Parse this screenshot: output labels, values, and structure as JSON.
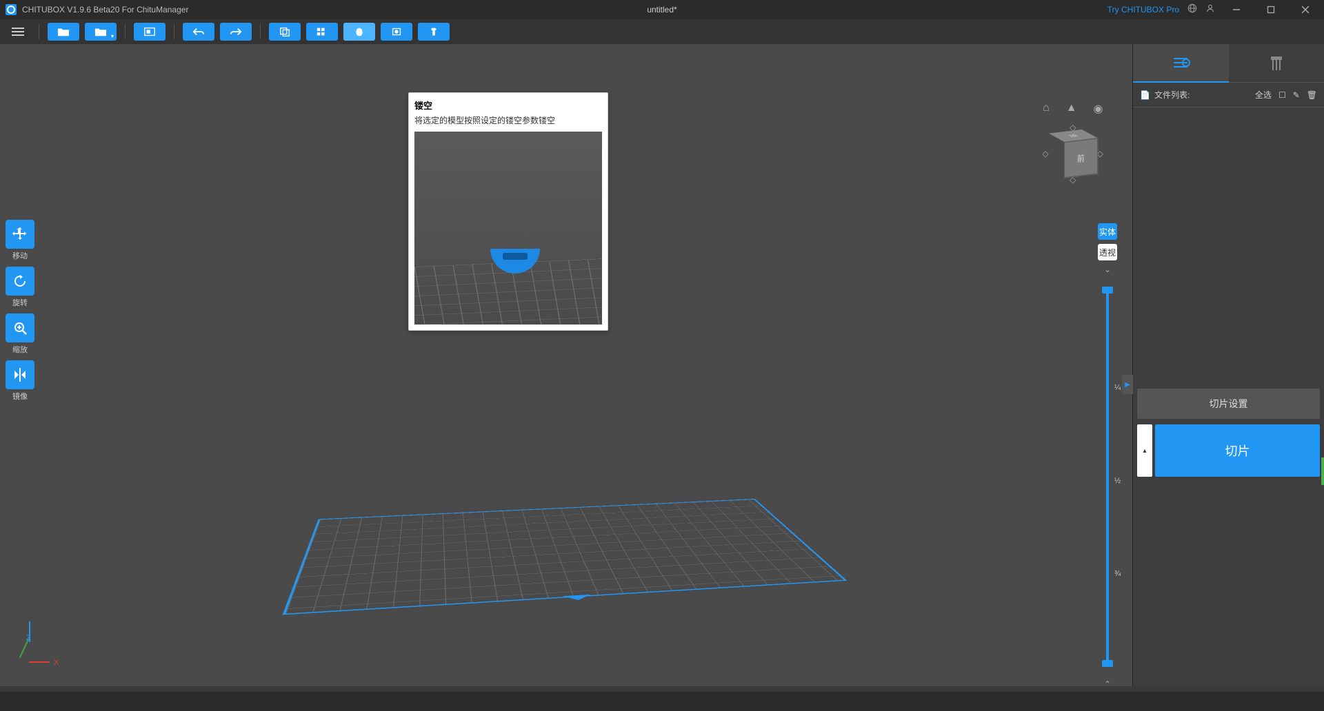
{
  "titlebar": {
    "app_title": "CHITUBOX V1.9.6 Beta20 For ChituManager",
    "doc_title": "untitled*",
    "try_pro": "Try CHITUBOX Pro"
  },
  "sidetools": [
    {
      "label": "移动",
      "name": "move"
    },
    {
      "label": "旋转",
      "name": "rotate"
    },
    {
      "label": "缩放",
      "name": "scale"
    },
    {
      "label": "镜像",
      "name": "mirror"
    }
  ],
  "tooltip": {
    "title": "镂空",
    "desc": "将选定的模型按照设定的镂空参数镂空"
  },
  "navcube": {
    "front": "前",
    "top": "顶"
  },
  "rslider": {
    "btn_solid": "实体",
    "btn_xray": "透视",
    "mark_1": "¼",
    "mark_2": "½",
    "mark_3": "¾"
  },
  "rpanel": {
    "file_list_label": "文件列表:",
    "select_all": "全选",
    "slice_settings": "切片设置",
    "slice": "切片"
  },
  "axis": {
    "x": "X",
    "z": "Z"
  }
}
